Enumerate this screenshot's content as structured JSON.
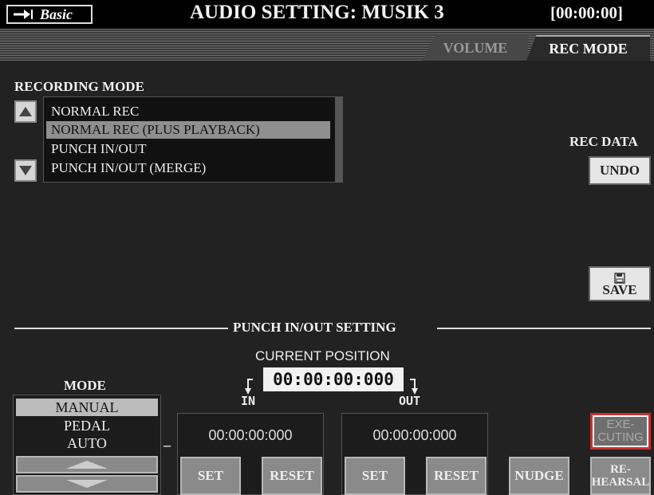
{
  "header": {
    "basic_label": "Basic",
    "title": "AUDIO SETTING: MUSIK 3",
    "timecode": "[00:00:00]"
  },
  "tabs": [
    {
      "label": "VOLUME",
      "active": false
    },
    {
      "label": "REC MODE",
      "active": true
    }
  ],
  "recording_mode": {
    "label": "RECORDING MODE",
    "items": [
      "NORMAL REC",
      "NORMAL REC (PLUS PLAYBACK)",
      "PUNCH IN/OUT",
      "PUNCH IN/OUT (MERGE)"
    ],
    "selected": "NORMAL REC (PLUS PLAYBACK)"
  },
  "rec_data": {
    "label": "REC DATA",
    "undo_label": "UNDO",
    "save_label": "SAVE"
  },
  "punch": {
    "section_label": "PUNCH IN/OUT SETTING",
    "current_position_label": "CURRENT POSITION",
    "current_position": "00:00:00:000",
    "in_label": "IN",
    "out_label": "OUT",
    "in_time": "00:00:00:000",
    "out_time": "00:00:00:000",
    "dash": "–",
    "mode_label": "MODE",
    "mode_items": [
      "MANUAL",
      "PEDAL",
      "AUTO"
    ],
    "mode_selected": "MANUAL",
    "set_label": "SET",
    "reset_label": "RESET",
    "nudge_label": "NUDGE",
    "executing_label_1": "EXE-",
    "executing_label_2": "CUTING",
    "rehearsal_label_1": "RE-",
    "rehearsal_label_2": "HEARSAL"
  },
  "colors": {
    "background": "#222222",
    "titlebar": "#000000",
    "selected_item": "#8f8f8f",
    "executing_border": "#c83030"
  }
}
